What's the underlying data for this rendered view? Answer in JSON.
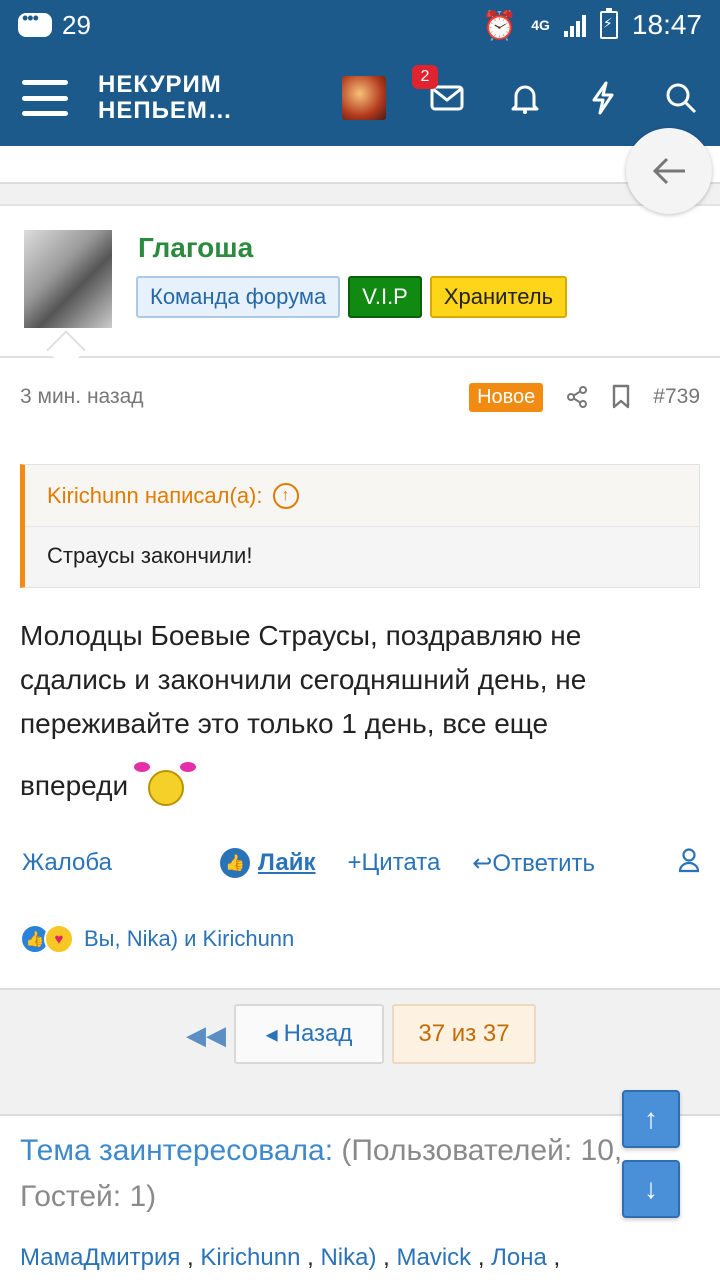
{
  "statusbar": {
    "notification_count": "29",
    "network": "4G",
    "time": "18:47"
  },
  "header": {
    "logo_line1": "НЕКУРИМ",
    "logo_line2": "НЕПЬЕМ…",
    "messages_badge": "2"
  },
  "post": {
    "author": "Глагоша",
    "tags": [
      "Команда форума",
      "V.I.P",
      "Хранитель"
    ],
    "time": "3 мин. назад",
    "new_label": "Новое",
    "number": "#739",
    "quote": {
      "author_line": "Kirichunn написал(а):",
      "text": "Страусы закончили!"
    },
    "body_lines": [
      "Молодцы Боевые Страусы, поздравляю не",
      "сдались и закончили сегодняшний день, не",
      "переживайте это только 1 день, все еще"
    ],
    "body_last": "впереди",
    "actions": {
      "complain": "Жалоба",
      "like": "Лайк",
      "quote": "Цитата",
      "reply": "Ответить"
    },
    "reactions_text": "Вы, Nika) и Kirichunn"
  },
  "pager": {
    "back": "Назад",
    "current": "37 из 37"
  },
  "interested": {
    "title": "Тема заинтересовала:",
    "details": "(Пользователей: 10, Гостей: 1)",
    "users": [
      "МамаДмитрия",
      "Kirichunn",
      "Nika)",
      "Mavick",
      "Лона"
    ]
  },
  "colors": {
    "header_bg": "#1d5a8c",
    "link": "#2a73b8",
    "accent_orange": "#f28b11",
    "author_green": "#2b8a3e"
  }
}
